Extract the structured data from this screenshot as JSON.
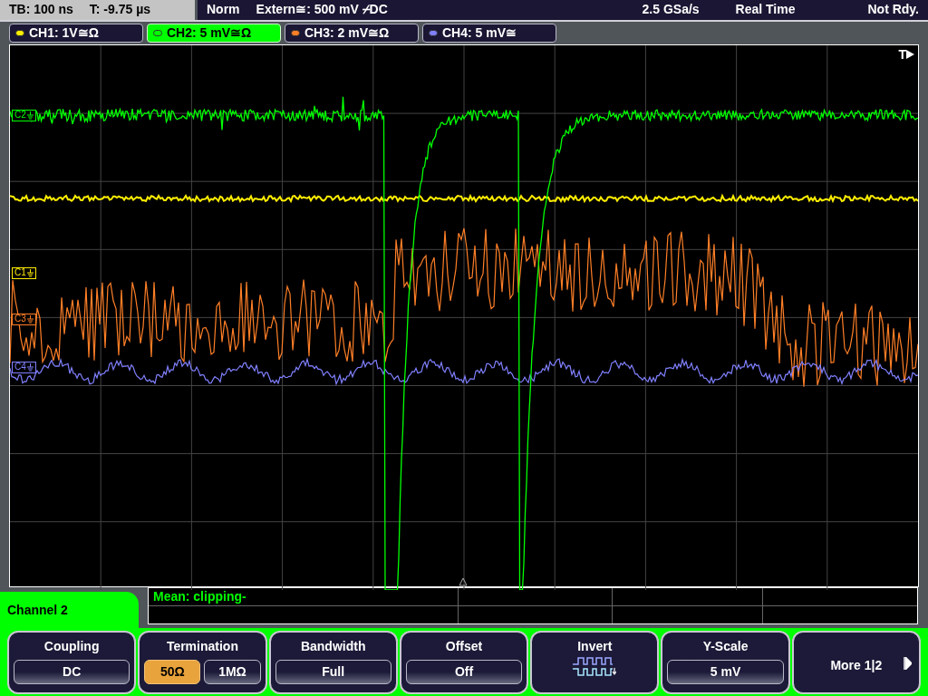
{
  "status_bar": {
    "timebase": "TB: 100 ns",
    "trigger_time": "T: -9.75 µs",
    "trigger_mode": "Norm",
    "trigger_source": "Extern≅: 500 mV ⌿DC",
    "sample_rate": "2.5 GSa/s",
    "acquisition": "Real Time",
    "state": "Not Rdy."
  },
  "channels": [
    {
      "label": "CH1: 1V≅Ω",
      "color": "#ffee00",
      "selected": false
    },
    {
      "label": "CH2: 5 mV≅Ω",
      "color": "#00ff00",
      "selected": true
    },
    {
      "label": "CH3: 2 mV≅Ω",
      "color": "#ff7f27",
      "selected": false
    },
    {
      "label": "CH4: 5 mV≅",
      "color": "#8080ff",
      "selected": false
    }
  ],
  "plot": {
    "trigger_label": "T",
    "markers": [
      {
        "label": "C2",
        "color": "#00ff00"
      },
      {
        "label": "C1",
        "color": "#ffee00"
      },
      {
        "label": "C3",
        "color": "#ff7f27"
      },
      {
        "label": "C4",
        "color": "#8080ff"
      }
    ]
  },
  "measurement": {
    "text": "Mean: clipping-"
  },
  "menu": {
    "title": "Channel 2",
    "softkeys": [
      {
        "kind": "value",
        "title": "Coupling",
        "value": "DC"
      },
      {
        "kind": "toggle",
        "title": "Termination",
        "options": [
          {
            "label": "50Ω",
            "selected": true
          },
          {
            "label": "1MΩ",
            "selected": false
          }
        ]
      },
      {
        "kind": "value",
        "title": "Bandwidth",
        "value": "Full"
      },
      {
        "kind": "value",
        "title": "Offset",
        "value": "Off"
      },
      {
        "kind": "icon",
        "title": "Invert"
      },
      {
        "kind": "value",
        "title": "Y-Scale",
        "value": "5 mV"
      },
      {
        "kind": "more",
        "title": "More 1|2"
      }
    ]
  }
}
